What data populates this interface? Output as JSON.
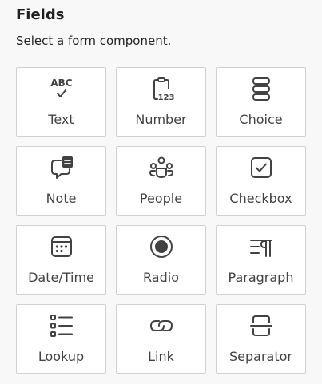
{
  "header": {
    "title": "Fields",
    "subtitle": "Select a form component."
  },
  "tiles": [
    {
      "label": "Text",
      "icon": "text-spellcheck-icon"
    },
    {
      "label": "Number",
      "icon": "clipboard-number-icon"
    },
    {
      "label": "Choice",
      "icon": "stacked-options-icon"
    },
    {
      "label": "Note",
      "icon": "comment-note-icon"
    },
    {
      "label": "People",
      "icon": "people-group-icon"
    },
    {
      "label": "Checkbox",
      "icon": "checkbox-checked-icon"
    },
    {
      "label": "Date/Time",
      "icon": "calendar-icon"
    },
    {
      "label": "Radio",
      "icon": "radio-button-icon"
    },
    {
      "label": "Paragraph",
      "icon": "paragraph-icon"
    },
    {
      "label": "Lookup",
      "icon": "bulleted-list-icon"
    },
    {
      "label": "Link",
      "icon": "link-icon"
    },
    {
      "label": "Separator",
      "icon": "separator-icon"
    }
  ],
  "icon_glyph_text": "ABC",
  "icon_glyph_number": "123"
}
